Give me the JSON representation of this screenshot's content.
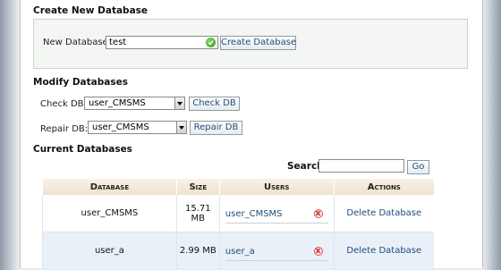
{
  "create": {
    "heading": "Create New Database",
    "label": "New Database:",
    "input_value": "test",
    "button": "Create Database"
  },
  "modify": {
    "heading": "Modify Databases",
    "check_label": "Check DB:",
    "check_selected": "user_CMSMS",
    "check_button": "Check DB",
    "repair_label": "Repair DB:",
    "repair_selected": "user_CMSMS",
    "repair_button": "Repair DB"
  },
  "current": {
    "heading": "Current Databases",
    "search_label": "Search",
    "search_value": "",
    "go_button": "Go",
    "columns": [
      "Database",
      "Size",
      "Users",
      "Actions"
    ],
    "rows": [
      {
        "database": "user_CMSMS",
        "size": "15.71 MB",
        "user": "user_CMSMS",
        "action": "Delete Database"
      },
      {
        "database": "user_a",
        "size": "2.99 MB",
        "user": "user_a",
        "action": "Delete Database"
      }
    ]
  },
  "colors": {
    "link": "#1d4c7a",
    "header_bg": "#f3e9d8",
    "alt_row": "#eaf0f7",
    "ok_icon": "#2e9a1a",
    "delete_icon": "#d9534f"
  },
  "icons": {
    "ok": "check-circle-icon",
    "delete": "remove-x-icon",
    "dropdown": "chevron-down-icon"
  }
}
